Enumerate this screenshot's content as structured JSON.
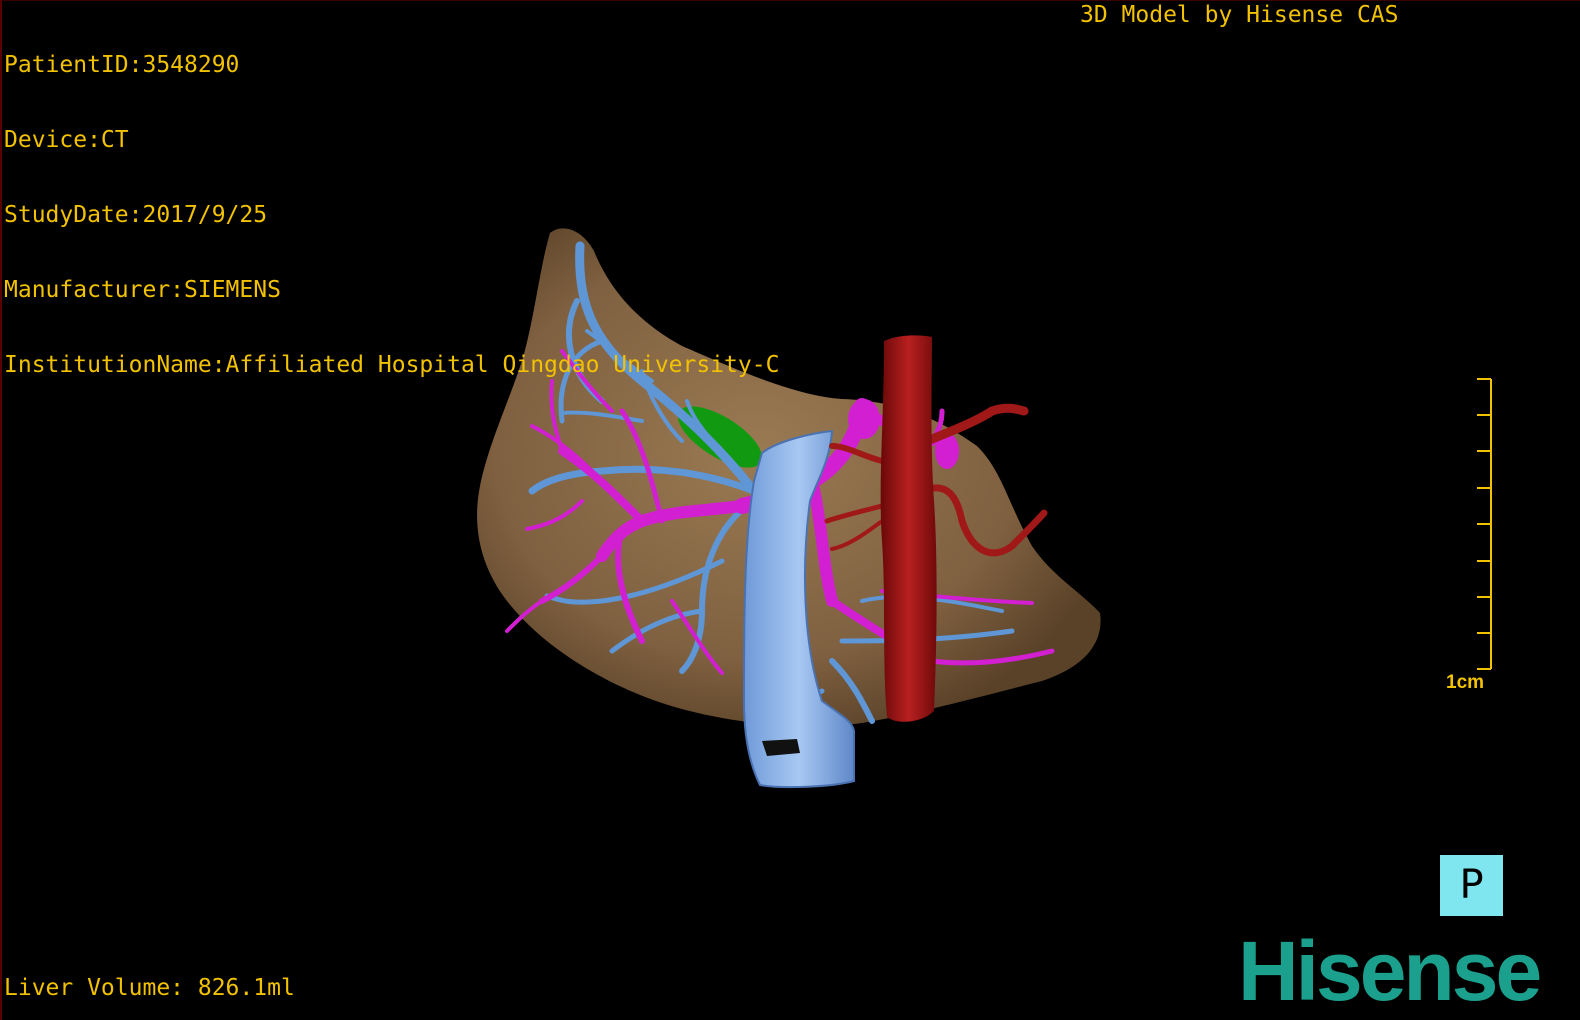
{
  "viewer": {
    "patient_info": [
      "PatientID:3548290",
      "Device:CT",
      "StudyDate:2017/9/25",
      "Manufacturer:SIEMENS",
      "InstitutionName:Affiliated Hospital Qingdao University-C"
    ],
    "credit": "3D Model by Hisense CAS",
    "liver_volume": "Liver Volume: 826.1ml",
    "scale_label": "1cm",
    "orientation": "P",
    "brand_logo": "Hisense"
  },
  "colors": {
    "overlay_text": "#f2c200",
    "liver": "#8a6a45",
    "portal_vein": "#d21fd2",
    "hepatic_vein": "#5f96d6",
    "ivc": "#8fb8ec",
    "artery": "#a01818",
    "gallbladder": "#119a11",
    "orientation_box": "#7fe6f0",
    "logo": "#1aa08c"
  }
}
